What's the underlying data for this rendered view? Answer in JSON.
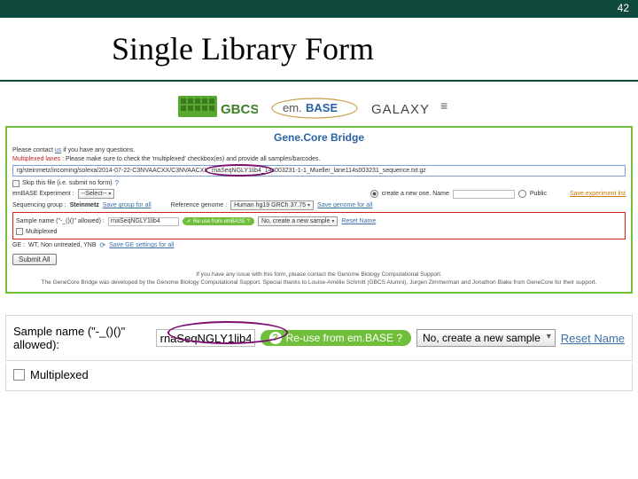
{
  "page": {
    "number": "42",
    "title": "Single Library Form"
  },
  "logos": {
    "gbcs": "GBCS",
    "embase": "em.BASE",
    "galaxy": "GALAXY"
  },
  "panel": {
    "bridge_title": "Gene.Core Bridge",
    "contact_prefix": "Please contact ",
    "contact_link": "us",
    "contact_suffix": " if you have any questions.",
    "multiplex_warn_label": "Multiplexed lanes :",
    "multiplex_warn_text": " Please make sure to check the 'multiplexed' checkbox(es) and provide all samples/barcodes.",
    "path": "rg/steinmetz/incoming/solexa/2014-07-22-C3NVAACXX/C3NVAACXX_rnaSeqNGLY1lib4_14s003231-1-1_Mueller_lane114s003231_sequence.txt.gz",
    "skip_label": "Skip this file (i.e. submit no form)",
    "help_icon": "?",
    "exp_label": "emBASE Experiment :",
    "exp_value": "--Select--",
    "create_new_label": "create a new one. Name",
    "public_label": "Public",
    "save_exp_link": "Save experiment list",
    "seq_group_label": "Sequencing group : ",
    "seq_group_value": "Steinmetz",
    "save_group_link": "Save group for all",
    "ref_gen_label": "Reference genome :",
    "ref_gen_value": "Human hg19 GRCh 37.75",
    "save_gen_link": "Save genome for all",
    "sample_name_label": "Sample name (\"-_()()\" allowed) :",
    "sample_name_value": "rnaSeqNGLY1lib4",
    "reuse_pill": "Re-use from emBASE ?",
    "reuse_dd": "No, create a new sample",
    "reset_name_link": "Reset Name",
    "multiplexed_label": "Multiplexed",
    "ge_label": "GE : ",
    "ge_value": "WT, Non untreated, YNB",
    "save_ge_link": "Save GE settings for all",
    "submit_all": "Submit All",
    "footer1": "If you have any issue with this form, please contact the Genome Biology Computational Support.",
    "footer2": "The GeneCore Bridge was developed by the Genome Biology Computational Support. Special thanks to Louise-Amélie Schmitt (GBCS Alumni), Jurgen Zimmerman and Jonathon Blake from GeneCore for their support."
  },
  "enlarged": {
    "sample_label": "Sample name (\"-_()()\" allowed):",
    "sample_value": "rnaSeqNGLY1lib4",
    "reuse_pill": "Re-use from em.BASE ?",
    "reuse_dd": "No, create a new sample",
    "reset_link": "Reset Name",
    "multiplexed_label": "Multiplexed"
  }
}
